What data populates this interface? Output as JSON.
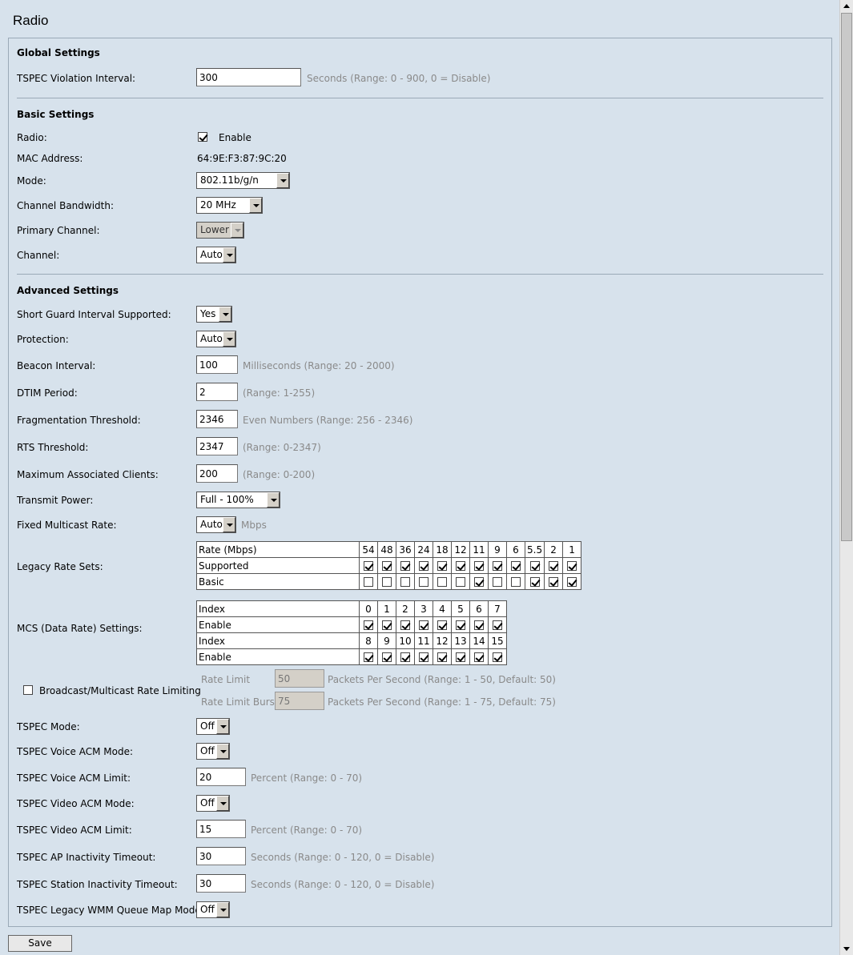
{
  "page": {
    "title": "Radio",
    "save_label": "Save"
  },
  "global": {
    "heading": "Global Settings",
    "tspec_violation_label": "TSPEC Violation Interval:",
    "tspec_violation_value": "300",
    "tspec_violation_hint": "Seconds (Range: 0 - 900, 0 = Disable)"
  },
  "basic": {
    "heading": "Basic Settings",
    "radio_label": "Radio:",
    "radio_enable_label": "Enable",
    "radio_enabled": true,
    "mac_label": "MAC Address:",
    "mac_value": "64:9E:F3:87:9C:20",
    "mode_label": "Mode:",
    "mode_value": "802.11b/g/n",
    "bandwidth_label": "Channel Bandwidth:",
    "bandwidth_value": "20 MHz",
    "primary_label": "Primary Channel:",
    "primary_value": "Lower",
    "channel_label": "Channel:",
    "channel_value": "Auto"
  },
  "advanced": {
    "heading": "Advanced Settings",
    "sgi_label": "Short Guard Interval Supported:",
    "sgi_value": "Yes",
    "protection_label": "Protection:",
    "protection_value": "Auto",
    "beacon_label": "Beacon Interval:",
    "beacon_value": "100",
    "beacon_hint": "Milliseconds (Range: 20 - 2000)",
    "dtim_label": "DTIM Period:",
    "dtim_value": "2",
    "dtim_hint": "(Range: 1-255)",
    "frag_label": "Fragmentation Threshold:",
    "frag_value": "2346",
    "frag_hint": "Even Numbers (Range: 256 - 2346)",
    "rts_label": "RTS Threshold:",
    "rts_value": "2347",
    "rts_hint": "(Range: 0-2347)",
    "maxclients_label": "Maximum Associated Clients:",
    "maxclients_value": "200",
    "maxclients_hint": "(Range: 0-200)",
    "txpower_label": "Transmit Power:",
    "txpower_value": "Full - 100%",
    "multicast_label": "Fixed Multicast Rate:",
    "multicast_value": "Auto",
    "multicast_unit": "Mbps",
    "legacy_label": "Legacy Rate Sets:",
    "legacy": {
      "header": "Rate (Mbps)",
      "rates": [
        "54",
        "48",
        "36",
        "24",
        "18",
        "12",
        "11",
        "9",
        "6",
        "5.5",
        "2",
        "1"
      ],
      "supported_label": "Supported",
      "supported": [
        true,
        true,
        true,
        true,
        true,
        true,
        true,
        true,
        true,
        true,
        true,
        true
      ],
      "basic_label": "Basic",
      "basic": [
        false,
        false,
        false,
        false,
        false,
        false,
        true,
        false,
        false,
        true,
        true,
        true
      ]
    },
    "mcs_label": "MCS (Data Rate) Settings:",
    "mcs": {
      "index_label": "Index",
      "enable_label": "Enable",
      "row1": [
        "0",
        "1",
        "2",
        "3",
        "4",
        "5",
        "6",
        "7"
      ],
      "row2": [
        "8",
        "9",
        "10",
        "11",
        "12",
        "13",
        "14",
        "15"
      ],
      "enable1": [
        true,
        true,
        true,
        true,
        true,
        true,
        true,
        true
      ],
      "enable2": [
        true,
        true,
        true,
        true,
        true,
        true,
        true,
        true
      ]
    },
    "bcast_label": "Broadcast/Multicast Rate Limiting",
    "bcast_enabled": false,
    "rate_limit_label": "Rate Limit",
    "rate_limit_value": "50",
    "rate_limit_hint": "Packets Per Second (Range: 1 - 50, Default: 50)",
    "rate_burst_label": "Rate Limit Burst",
    "rate_burst_value": "75",
    "rate_burst_hint": "Packets Per Second (Range: 1 - 75, Default: 75)",
    "tspec_mode_label": "TSPEC Mode:",
    "tspec_mode_value": "Off",
    "voice_acm_mode_label": "TSPEC Voice ACM Mode:",
    "voice_acm_mode_value": "Off",
    "voice_acm_limit_label": "TSPEC Voice ACM Limit:",
    "voice_acm_limit_value": "20",
    "voice_acm_limit_hint": "Percent (Range: 0 - 70)",
    "video_acm_mode_label": "TSPEC Video ACM Mode:",
    "video_acm_mode_value": "Off",
    "video_acm_limit_label": "TSPEC Video ACM Limit:",
    "video_acm_limit_value": "15",
    "video_acm_limit_hint": "Percent (Range: 0 - 70)",
    "ap_inact_label": "TSPEC AP Inactivity Timeout:",
    "ap_inact_value": "30",
    "ap_inact_hint": "Seconds (Range: 0 - 120, 0 = Disable)",
    "sta_inact_label": "TSPEC Station Inactivity Timeout:",
    "sta_inact_value": "30",
    "sta_inact_hint": "Seconds (Range: 0 - 120, 0 = Disable)",
    "wmm_label": "TSPEC Legacy WMM Queue Map Mode:",
    "wmm_value": "Off"
  }
}
